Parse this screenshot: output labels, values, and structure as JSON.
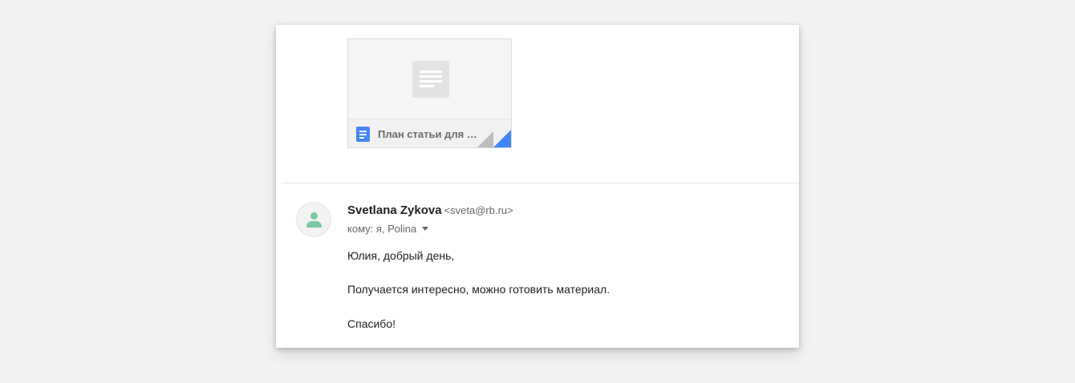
{
  "attachment": {
    "file_name": "План статьи для R...",
    "file_icon": "google-docs-icon",
    "preview_icon": "document-preview-icon",
    "accent_color": "#4285f4"
  },
  "message": {
    "sender_name": "Svetlana Zykova",
    "sender_email": "<sveta@rb.ru>",
    "recipients": "кому: я, Polina",
    "avatar_icon": "person-icon",
    "avatar_color": "#7cc9a2",
    "body": [
      "Юлия, добрый день,",
      "Получается интересно, можно готовить материал.",
      "Спасибо!"
    ]
  }
}
